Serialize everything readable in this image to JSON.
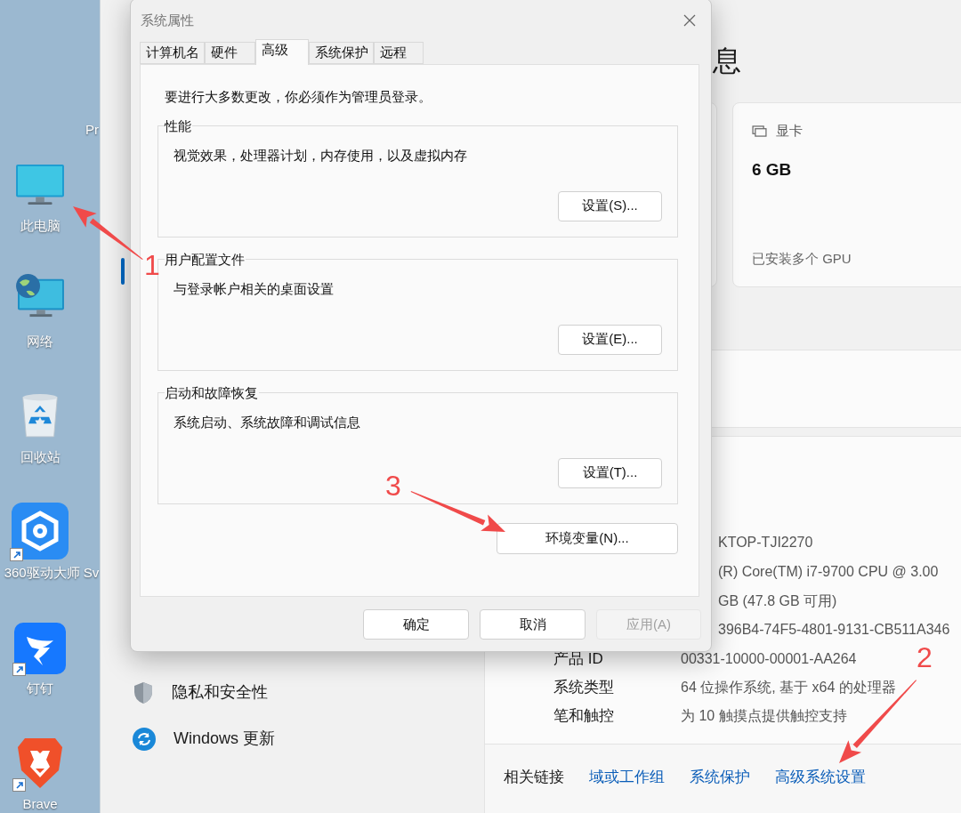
{
  "desktop": {
    "cut_label": "Pr",
    "icons": [
      {
        "kind": "pc",
        "label": "此电脑"
      },
      {
        "kind": "network",
        "label": "网络"
      },
      {
        "kind": "recycle",
        "label": "回收站"
      },
      {
        "kind": "driver",
        "label": "360驱动大师 Sv",
        "shortcut": true
      },
      {
        "kind": "dingtalk",
        "label": "钉钉",
        "shortcut": true
      },
      {
        "kind": "brave",
        "label": "Brave",
        "shortcut": true
      }
    ]
  },
  "settings": {
    "title_fragment": "息",
    "gpu_card": {
      "label": "显卡",
      "value": "6 GB",
      "note": "已安装多个 GPU"
    },
    "specs": [
      {
        "value": "KTOP-TJI2270"
      },
      {
        "value": "(R) Core(TM) i7-9700 CPU @ 3.00"
      },
      {
        "value": "GB (47.8 GB 可用)"
      },
      {
        "value": "396B4-74F5-4801-9131-CB511A346"
      },
      {
        "label": "产品 ID",
        "value": "00331-10000-00001-AA264"
      },
      {
        "label": "系统类型",
        "value": "64 位操作系统, 基于 x64 的处理器"
      },
      {
        "label": "笔和触控",
        "value": "为 10 触摸点提供触控支持"
      }
    ],
    "related": {
      "label": "相关链接",
      "links": [
        "域或工作组",
        "系统保护",
        "高级系统设置"
      ]
    },
    "sidebar": [
      {
        "kind": "privacy",
        "label": "隐私和安全性"
      },
      {
        "kind": "update",
        "label": "Windows 更新"
      }
    ]
  },
  "dialog": {
    "title": "系统属性",
    "tabs": [
      {
        "label": "计算机名",
        "selected": false
      },
      {
        "label": "硬件",
        "selected": false
      },
      {
        "label": "高级",
        "selected": true
      },
      {
        "label": "系统保护",
        "selected": false
      },
      {
        "label": "远程",
        "selected": false
      }
    ],
    "notice": "要进行大多数更改，你必须作为管理员登录。",
    "groups": [
      {
        "title": "性能",
        "description": "视觉效果，处理器计划，内存使用，以及虚拟内存",
        "button": "设置(S)..."
      },
      {
        "title": "用户配置文件",
        "description": "与登录帐户相关的桌面设置",
        "button": "设置(E)..."
      },
      {
        "title": "启动和故障恢复",
        "description": "系统启动、系统故障和调试信息",
        "button": "设置(T)..."
      }
    ],
    "env_button": "环境变量(N)...",
    "buttons": [
      {
        "label": "确定",
        "disabled": false
      },
      {
        "label": "取消",
        "disabled": false
      },
      {
        "label": "应用(A)",
        "disabled": true
      }
    ]
  },
  "annotations": [
    {
      "text": "1"
    },
    {
      "text": "3"
    },
    {
      "text": "2"
    }
  ]
}
